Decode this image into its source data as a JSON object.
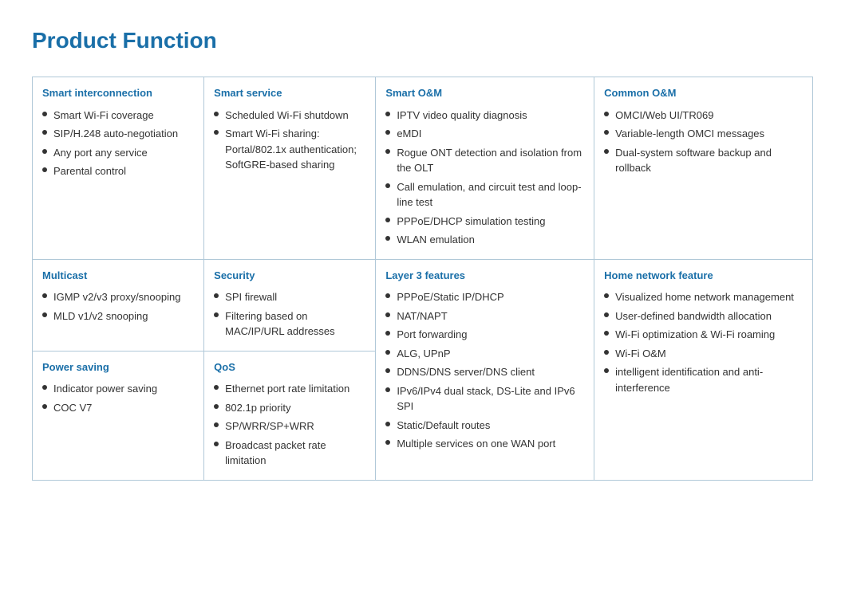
{
  "title": "Product Function",
  "table": {
    "row1": [
      {
        "header": "Smart interconnection",
        "items": [
          "Smart Wi-Fi coverage",
          "SIP/H.248 auto-negotiation",
          "Any port any service",
          "Parental control"
        ]
      },
      {
        "header": "Smart service",
        "items": [
          "Scheduled Wi-Fi shutdown",
          "Smart Wi-Fi sharing: Portal/802.1x authentication; SoftGRE-based sharing"
        ]
      },
      {
        "header": "Smart O&M",
        "items": [
          "IPTV video quality diagnosis",
          "eMDI",
          "Rogue ONT detection and isolation from the OLT",
          "Call emulation, and circuit test and loop-line test",
          "PPPoE/DHCP simulation testing",
          "WLAN emulation"
        ]
      },
      {
        "header": "Common O&M",
        "items": [
          "OMCI/Web UI/TR069",
          "Variable-length OMCI messages",
          "Dual-system software backup and rollback"
        ]
      }
    ],
    "row2": [
      {
        "header": "Multicast",
        "items": [
          "IGMP v2/v3 proxy/snooping",
          "MLD v1/v2 snooping"
        ]
      },
      {
        "header": "Security",
        "items": [
          "SPI firewall",
          "Filtering based on MAC/IP/URL addresses"
        ]
      },
      {
        "header": "Layer 3 features",
        "items": [
          "PPPoE/Static IP/DHCP",
          "NAT/NAPT",
          "Port forwarding",
          "ALG, UPnP",
          "DDNS/DNS server/DNS client",
          "IPv6/IPv4 dual stack, DS-Lite and IPv6 SPI",
          "Static/Default routes",
          "Multiple services on one WAN port"
        ]
      },
      {
        "header": "Home network feature",
        "items": [
          "Visualized home network management",
          "User-defined bandwidth allocation",
          "Wi-Fi optimization & Wi-Fi roaming",
          "Wi-Fi O&M",
          "intelligent identification and anti-interference"
        ]
      }
    ],
    "row3_col1": {
      "header": "Power saving",
      "items": [
        "Indicator power saving",
        "COC V7"
      ]
    },
    "row3_col2": {
      "header": "QoS",
      "items": [
        "Ethernet port rate limitation",
        "802.1p priority",
        "SP/WRR/SP+WRR",
        "Broadcast packet rate limitation"
      ]
    }
  }
}
